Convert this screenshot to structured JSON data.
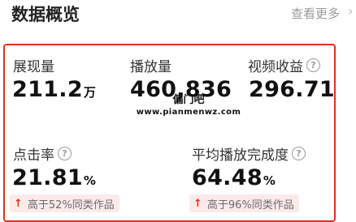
{
  "header": {
    "title": "数据概览",
    "view_more": "查看更多",
    "arrow": "›"
  },
  "metrics_row1": [
    {
      "label": "展现量",
      "value": "211.2",
      "unit": "万",
      "help": false
    },
    {
      "label": "播放量",
      "value": "460,836",
      "unit": "",
      "help": false
    },
    {
      "label": "视频收益",
      "value": "296.71",
      "unit": "",
      "help": true
    }
  ],
  "metrics_row2": [
    {
      "label": "点击率",
      "value": "21.81",
      "unit": "%",
      "help": true,
      "badge": "高于52%同类作品"
    },
    {
      "label": "平均播放完成度",
      "value": "64.48",
      "unit": "%",
      "help": true,
      "badge": "高于96%同类作品"
    }
  ],
  "icons": {
    "help": "?",
    "up_arrow": "↑"
  },
  "watermark": {
    "cn": "偏门吧",
    "en": "www.pianmenwz.com"
  },
  "colors": {
    "accent": "#e0301e",
    "badge_bg": "#fbeaea",
    "muted": "#9a9a9a"
  }
}
